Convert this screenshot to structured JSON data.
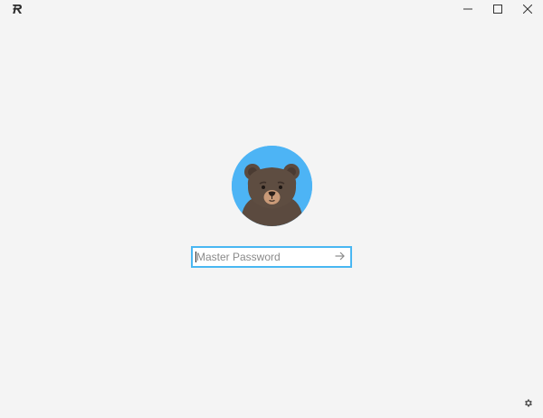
{
  "app": {
    "logo_icon": "roboform-r-logo-icon",
    "accent_color": "#49b7f2",
    "background_color": "#f4f4f4"
  },
  "window_controls": {
    "minimize_icon": "minimize-icon",
    "maximize_icon": "maximize-icon",
    "close_icon": "close-icon"
  },
  "login": {
    "avatar_icon": "bear-avatar-icon",
    "avatar_background": "#4db4f5",
    "password_placeholder": "Master Password",
    "password_value": "",
    "submit_icon": "arrow-right-icon"
  },
  "footer": {
    "settings_icon": "gear-icon"
  }
}
